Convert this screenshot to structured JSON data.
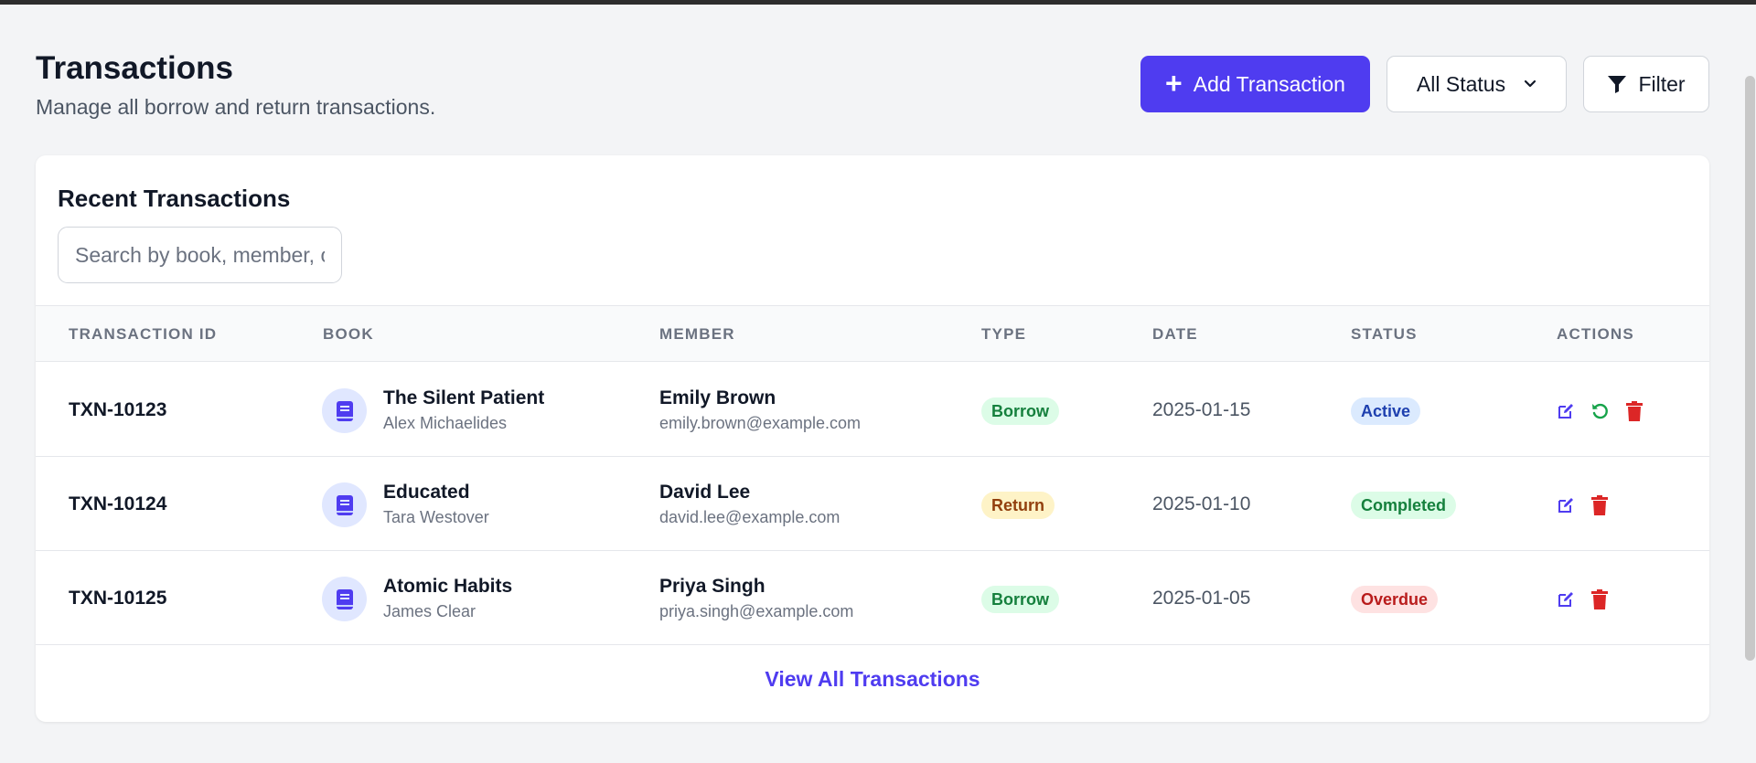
{
  "header": {
    "title": "Transactions",
    "subtitle": "Manage all borrow and return transactions."
  },
  "toolbar": {
    "add_label": "Add Transaction",
    "status_select": "All Status",
    "filter_label": "Filter"
  },
  "card": {
    "title": "Recent Transactions",
    "search_placeholder": "Search by book, member, or ID..."
  },
  "table": {
    "columns": [
      "TRANSACTION ID",
      "BOOK",
      "MEMBER",
      "TYPE",
      "DATE",
      "STATUS",
      "ACTIONS"
    ],
    "rows": [
      {
        "id": "TXN-10123",
        "book_title": "The Silent Patient",
        "book_author": "Alex Michaelides",
        "member_name": "Emily Brown",
        "member_email": "emily.brown@example.com",
        "type": "Borrow",
        "date": "2025-01-15",
        "status": "Active",
        "actions": [
          "edit-icon",
          "return-icon",
          "trash-icon"
        ]
      },
      {
        "id": "TXN-10124",
        "book_title": "Educated",
        "book_author": "Tara Westover",
        "member_name": "David Lee",
        "member_email": "david.lee@example.com",
        "type": "Return",
        "date": "2025-01-10",
        "status": "Completed",
        "actions": [
          "edit-icon",
          "trash-icon"
        ]
      },
      {
        "id": "TXN-10125",
        "book_title": "Atomic Habits",
        "book_author": "James Clear",
        "member_name": "Priya Singh",
        "member_email": "priya.singh@example.com",
        "type": "Borrow",
        "date": "2025-01-05",
        "status": "Overdue",
        "actions": [
          "edit-icon",
          "trash-icon"
        ]
      }
    ]
  },
  "footer": {
    "view_all_label": "View All Transactions"
  },
  "colors": {
    "accent": "#4f3cf0",
    "edit": "#4f3cf0",
    "return": "#16a34a",
    "delete": "#dc2626",
    "badge_green": "#dcfce7",
    "badge_yellow": "#fef3c7",
    "badge_blue": "#dbeafe",
    "badge_red": "#fee2e2"
  }
}
